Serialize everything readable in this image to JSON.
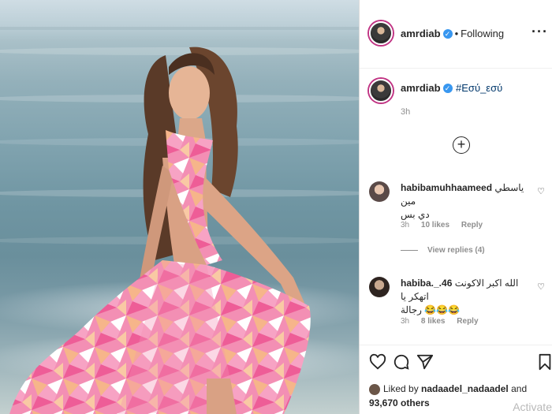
{
  "post": {
    "author": "amrdiab",
    "follow_status": "Following",
    "caption_user": "amrdiab",
    "caption_hashtag": "#Εσύ_εσύ",
    "caption_time": "3h"
  },
  "comments": [
    {
      "user": "habibamuhhaameed",
      "text_line1": "ياسطي مين",
      "text_line2": "دي بس",
      "time": "3h",
      "likes": "10 likes",
      "reply": "Reply",
      "view_replies": "View replies (4)"
    },
    {
      "user": "habiba._.46",
      "text_line1": "الله اكبر الاكونت اتهكر يا",
      "text_line2": "رجالة 😂😂😂",
      "time": "3h",
      "likes": "8 likes",
      "reply": "Reply"
    }
  ],
  "likes": {
    "prefix": "Liked by",
    "user": "nadaadel_nadaadel",
    "and": "and",
    "others": "93,670 others"
  },
  "icons": {
    "more": "more-options-icon",
    "add": "add-comment-icon",
    "like": "heart-icon",
    "comment": "comment-icon",
    "share": "share-icon",
    "save": "bookmark-icon"
  },
  "watermark": "Activate",
  "colors": {
    "verified": "#3897f0",
    "hashtag": "#00376b",
    "muted": "#8e8e8e",
    "story_ring": "#c13584"
  }
}
